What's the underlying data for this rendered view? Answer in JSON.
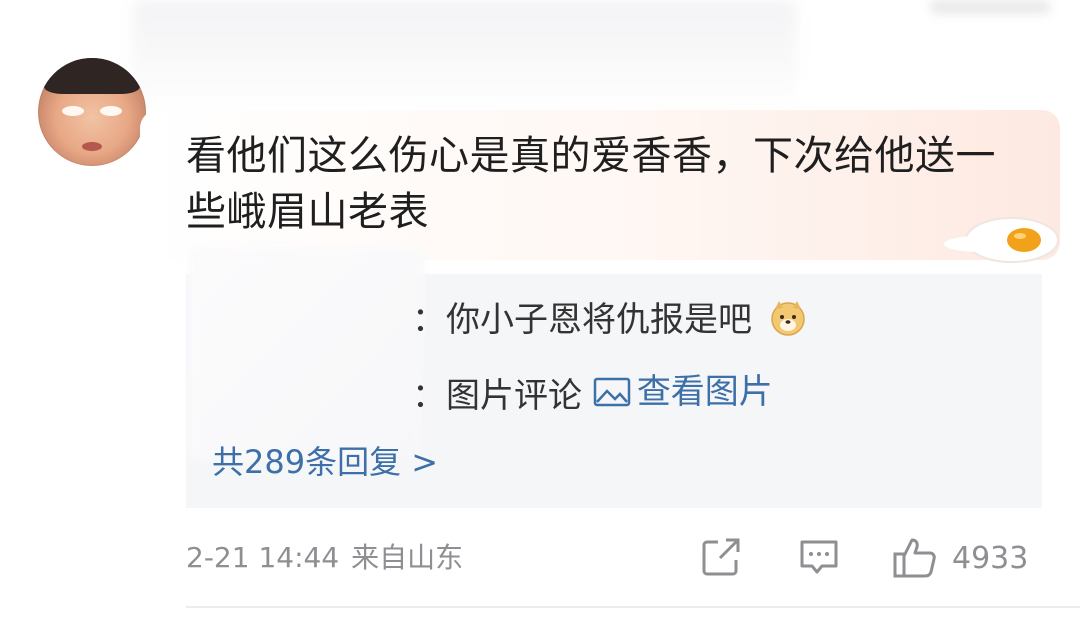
{
  "comment": {
    "text": "看他们这么伤心是真的爱香香，下次给他送一些峨眉山老表"
  },
  "replies": {
    "line1_text": "：你小子恩将仇报是吧",
    "line1_emoji": "doge-emoji",
    "line2_prefix": "：图片评论 ",
    "line2_link": "查看图片",
    "more_label": "共289条回复 >"
  },
  "meta": {
    "date": "2-21 14:44",
    "location": "来自山东"
  },
  "actions": {
    "share_icon": "share-icon",
    "comment_icon": "comment-icon",
    "like_icon": "thumbs-up-icon",
    "like_count": "4933"
  },
  "colors": {
    "link": "#3d6fa8",
    "meta_text": "#8e8e93",
    "reply_bg": "#f5f6f8"
  }
}
